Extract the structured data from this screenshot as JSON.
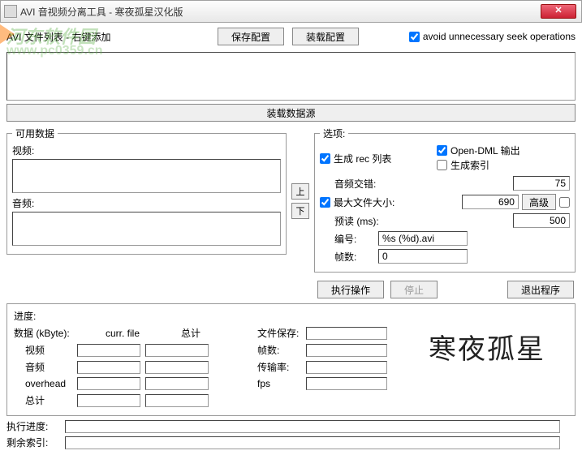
{
  "window": {
    "title": "AVI 音视频分离工具 - 寒夜孤星汉化版"
  },
  "watermark": {
    "line1": "河东软件园",
    "line2": "www.pc0359.cn"
  },
  "toolbar": {
    "file_list_label": "AVI 文件列表 - 右键添加",
    "save_config": "保存配置",
    "load_config": "装载配置",
    "avoid_seek": "avoid unnecessary seek operations"
  },
  "load_source": "装载数据源",
  "available": {
    "legend": "可用数据",
    "video_label": "视频:",
    "audio_label": "音频:"
  },
  "updown": {
    "up": "上",
    "down": "下"
  },
  "options": {
    "legend": "选项:",
    "gen_rec": "生成 rec 列表",
    "open_dml": "Open-DML 输出",
    "gen_index": "生成索引",
    "audio_interleave": "音频交错:",
    "audio_interleave_val": "75",
    "max_filesize": "最大文件大小:",
    "max_filesize_val": "690",
    "advanced": "高级",
    "preload": "预读 (ms):",
    "preload_val": "500",
    "numbering": "编号:",
    "numbering_val": "%s (%d).avi",
    "frames": "帧数:",
    "frames_val": "0"
  },
  "actions": {
    "execute": "执行操作",
    "stop": "停止",
    "exit": "退出程序"
  },
  "progress": {
    "legend": "进度:",
    "data_label": "数据 (kByte):",
    "curr_file": "curr. file",
    "total": "总计",
    "video": "视频",
    "audio": "音频",
    "overhead": "overhead",
    "sum": "总计",
    "file_save": "文件保存:",
    "frames": "帧数:",
    "rate": "传输率:",
    "fps": "fps"
  },
  "bottom": {
    "exec_progress": "执行进度:",
    "remain_index": "剩余索引:"
  },
  "logo": "寒夜孤星"
}
